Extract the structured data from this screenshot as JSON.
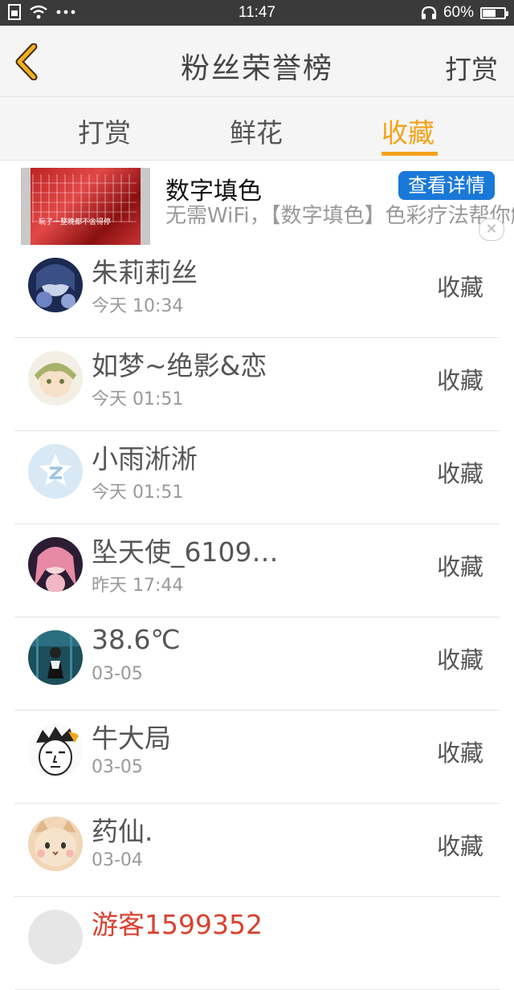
{
  "status_bar": {
    "time": "11:47",
    "battery_percent": "60%",
    "battery_level": 0.6
  },
  "header": {
    "title": "粉丝荣誉榜",
    "right_action": "打赏"
  },
  "tabs": [
    {
      "label": "打赏",
      "active": false
    },
    {
      "label": "鲜花",
      "active": false
    },
    {
      "label": "收藏",
      "active": true
    }
  ],
  "ad": {
    "thumb_caption": "玩了一整晚都不舍得停",
    "title": "数字填色",
    "description": "无需WiFi，【数字填色】色彩疗法帮你解压",
    "cta": "查看详情",
    "close": "✕"
  },
  "colors": {
    "accent": "#f4a21a",
    "ad_button": "#1a78d8",
    "status_bar": "#3a3a3a"
  },
  "list": [
    {
      "name": "朱莉莉丝",
      "time": "今天  10:34",
      "action": "收藏",
      "avatar": "anime-blue"
    },
    {
      "name": "如梦~绝影&恋",
      "time": "今天  01:51",
      "action": "收藏",
      "avatar": "anime-green"
    },
    {
      "name": "小雨淅淅",
      "time": "今天  01:51",
      "action": "收藏",
      "avatar": "default-z"
    },
    {
      "name": "坠天使_6109…",
      "time": "昨天  17:44",
      "action": "收藏",
      "avatar": "anime-pink"
    },
    {
      "name": "38.6℃",
      "time": "03-05",
      "action": "收藏",
      "avatar": "photo-teal"
    },
    {
      "name": "牛大局",
      "time": "03-05",
      "action": "收藏",
      "avatar": "cartoon-face"
    },
    {
      "name": "药仙.",
      "time": "03-04",
      "action": "收藏",
      "avatar": "cat"
    },
    {
      "name": "游客1599352",
      "time": "",
      "action": "",
      "avatar": "partial"
    }
  ]
}
